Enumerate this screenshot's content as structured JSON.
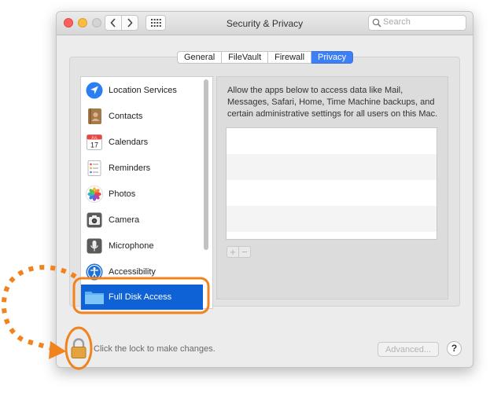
{
  "window": {
    "title": "Security & Privacy"
  },
  "search": {
    "placeholder": "Search"
  },
  "tabs": [
    {
      "label": "General",
      "active": false
    },
    {
      "label": "FileVault",
      "active": false
    },
    {
      "label": "Firewall",
      "active": false
    },
    {
      "label": "Privacy",
      "active": true
    }
  ],
  "privacy_list": [
    {
      "label": "Location Services",
      "icon": "location-arrow-icon"
    },
    {
      "label": "Contacts",
      "icon": "contacts-book-icon"
    },
    {
      "label": "Calendars",
      "icon": "calendar-icon",
      "icon_text_month": "JUL",
      "icon_text_day": "17"
    },
    {
      "label": "Reminders",
      "icon": "reminders-icon"
    },
    {
      "label": "Photos",
      "icon": "photos-icon"
    },
    {
      "label": "Camera",
      "icon": "camera-icon"
    },
    {
      "label": "Microphone",
      "icon": "microphone-icon"
    },
    {
      "label": "Accessibility",
      "icon": "accessibility-icon"
    },
    {
      "label": "Full Disk Access",
      "icon": "folder-icon",
      "selected": true
    }
  ],
  "detail": {
    "description": "Allow the apps below to access data like Mail, Messages, Safari, Home, Time Machine backups, and certain administrative settings for all users on this Mac.",
    "add_label": "+",
    "remove_label": "−"
  },
  "footer": {
    "lock_text": "Click the lock to make changes.",
    "advanced_label": "Advanced...",
    "help_label": "?"
  },
  "colors": {
    "selection": "#0f62d6",
    "active_tab": "#3d7ff5",
    "annotation": "#f0831e"
  }
}
